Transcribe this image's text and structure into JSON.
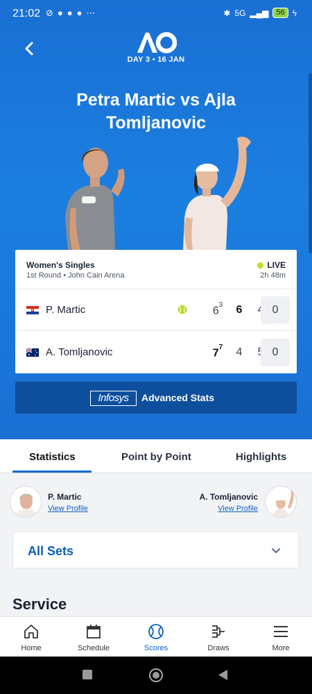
{
  "status_bar": {
    "time": "21:02",
    "network": "5G",
    "battery": "56"
  },
  "header": {
    "logo_text": "AO",
    "day_label": "DAY 3 • 16 JAN"
  },
  "match": {
    "title": "Petra Martic vs Ajla Tomljanovic",
    "event": "Women's Singles",
    "round": "1st Round • John Cain Arena",
    "status": "LIVE",
    "duration": "2h 48m",
    "players": [
      {
        "name": "P. Martic",
        "country": "Croatia",
        "serving": true,
        "sets": [
          {
            "games": "6",
            "tiebreak": "3",
            "won": false
          },
          {
            "games": "6",
            "tiebreak": "",
            "won": true
          },
          {
            "games": "4",
            "tiebreak": "",
            "won": false
          }
        ],
        "points": "0"
      },
      {
        "name": "A. Tomljanovic",
        "country": "Australia",
        "serving": false,
        "sets": [
          {
            "games": "7",
            "tiebreak": "7",
            "won": true
          },
          {
            "games": "4",
            "tiebreak": "",
            "won": false
          },
          {
            "games": "5",
            "tiebreak": "",
            "won": false
          }
        ],
        "points": "0"
      }
    ]
  },
  "advanced_stats": {
    "brand": "Infosys",
    "label": "Advanced Stats"
  },
  "tabs": [
    {
      "label": "Statistics",
      "active": true
    },
    {
      "label": "Point by Point",
      "active": false
    },
    {
      "label": "Highlights",
      "active": false
    }
  ],
  "compare": {
    "left": {
      "name": "P. Martic",
      "link": "View Profile"
    },
    "right": {
      "name": "A. Tomljanovic",
      "link": "View Profile"
    }
  },
  "sets_filter": {
    "selected": "All Sets"
  },
  "section": {
    "title": "Service"
  },
  "bottom_nav": [
    {
      "label": "Home",
      "icon": "home-icon"
    },
    {
      "label": "Schedule",
      "icon": "calendar-icon"
    },
    {
      "label": "Scores",
      "icon": "tennis-ball-icon",
      "active": true
    },
    {
      "label": "Draws",
      "icon": "bracket-icon"
    },
    {
      "label": "More",
      "icon": "menu-icon"
    }
  ],
  "colors": {
    "hero_blue": "#1b7fe0",
    "stats_button": "#0e4f9d",
    "accent": "#0a63c2",
    "live_dot": "#c2d92b"
  }
}
